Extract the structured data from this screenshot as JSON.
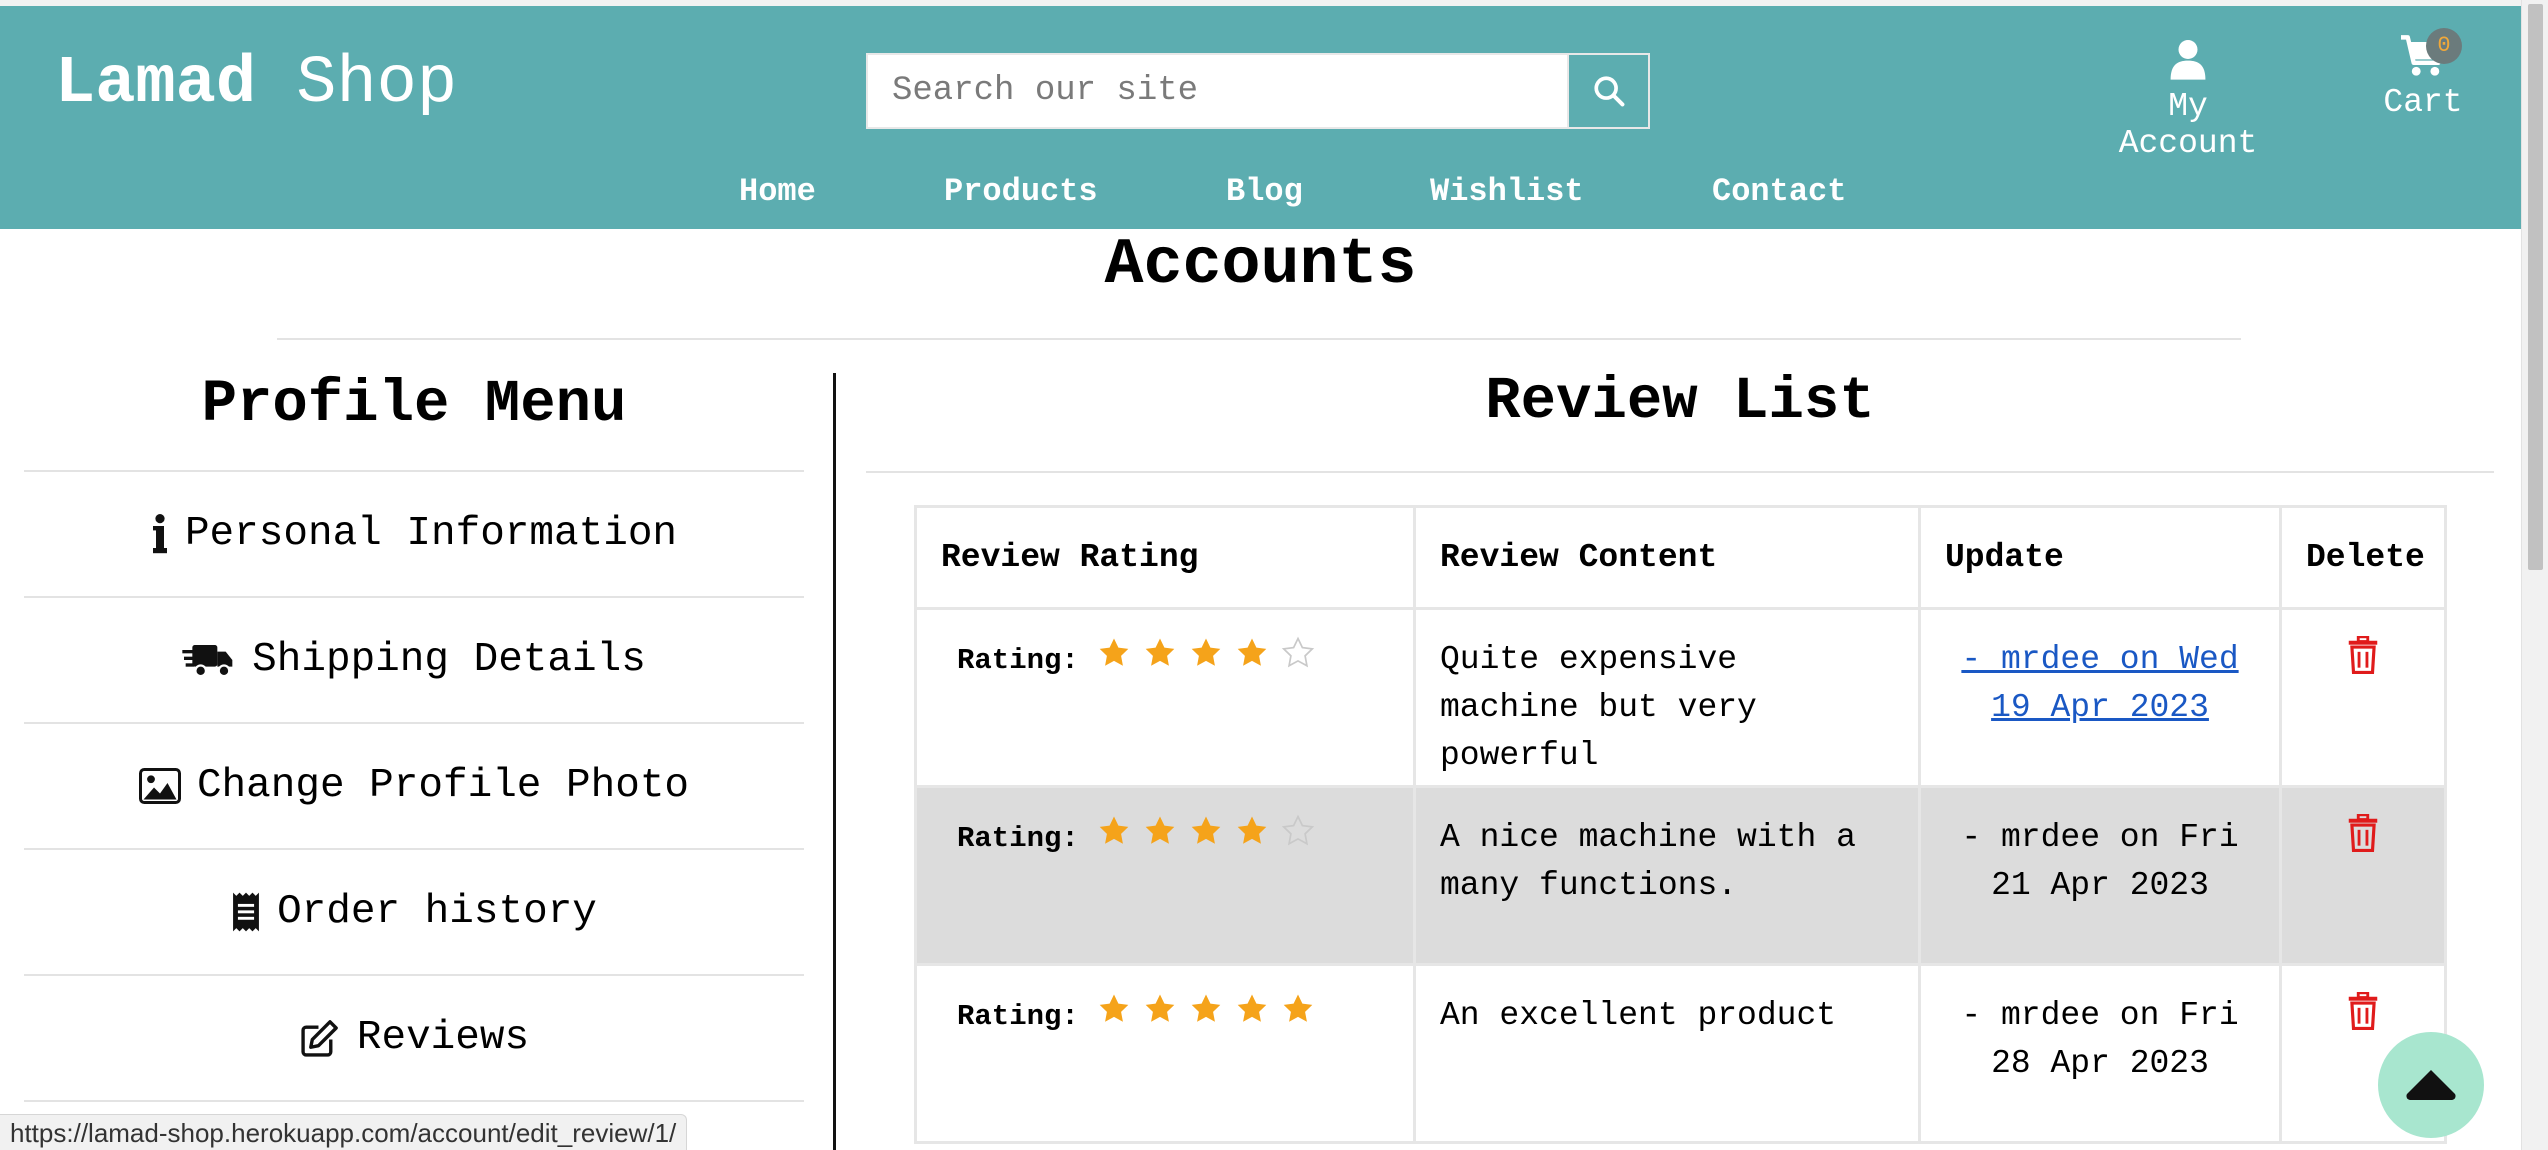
{
  "header": {
    "brand_bold": "Lamad",
    "brand_rest": " Shop",
    "search_placeholder": "Search our site",
    "account_label": "My Account",
    "cart_label": "Cart",
    "cart_count": "0",
    "nav": [
      {
        "label": "Home"
      },
      {
        "label": "Products"
      },
      {
        "label": "Blog"
      },
      {
        "label": "Wishlist"
      },
      {
        "label": "Contact"
      }
    ]
  },
  "page": {
    "title": "Accounts"
  },
  "profile_menu": {
    "title": "Profile Menu",
    "items": [
      {
        "label": "Personal Information",
        "icon": "info-icon"
      },
      {
        "label": "Shipping Details",
        "icon": "truck-fast-icon"
      },
      {
        "label": "Change Profile Photo",
        "icon": "image-icon"
      },
      {
        "label": "Order history",
        "icon": "receipt-icon"
      },
      {
        "label": "Reviews",
        "icon": "edit-icon"
      }
    ]
  },
  "review_list": {
    "title": "Review List",
    "columns": [
      "Review Rating",
      "Review Content",
      "Update",
      "Delete"
    ],
    "rating_label": "Rating:",
    "rows": [
      {
        "stars": 4,
        "content": "Quite expensive machine but very powerful",
        "update": "- mrdee on Wed 19 Apr 2023",
        "update_is_link": true
      },
      {
        "stars": 4,
        "content": "A nice machine with a many functions.",
        "update": "- mrdee on Fri 21 Apr 2023",
        "update_is_link": false
      },
      {
        "stars": 5,
        "content": "An excellent product",
        "update": "- mrdee on Fri 28 Apr 2023",
        "update_is_link": false
      }
    ]
  },
  "status_bar": {
    "url": "https://lamad-shop.herokuapp.com/account/edit_review/1/"
  },
  "colors": {
    "header_bg": "#5cadb0",
    "star_filled": "#f5a31a",
    "delete_red": "#e01b1b",
    "link_blue": "#1a58c4",
    "back_to_top_bg": "#a8e6cf"
  }
}
